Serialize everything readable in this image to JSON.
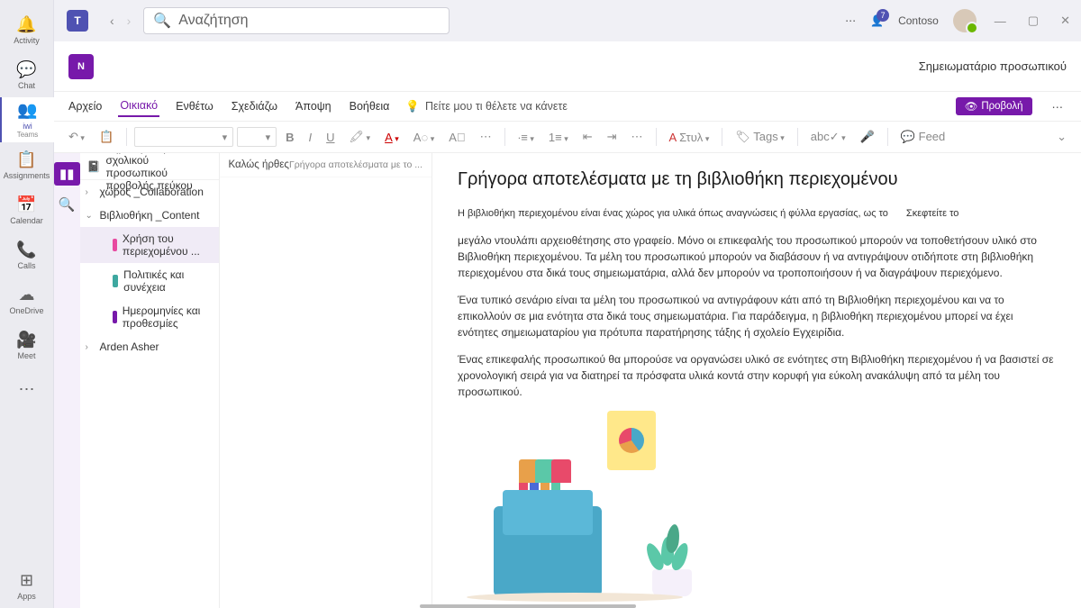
{
  "rail": {
    "items": [
      {
        "label": "Activity",
        "icon": "🔔"
      },
      {
        "label": "Chat",
        "icon": "💬"
      },
      {
        "label": "iwi",
        "sub": "Teams",
        "icon": "👥"
      },
      {
        "label": "Assignments",
        "icon": "📋"
      },
      {
        "label": "Calendar",
        "icon": "📅"
      },
      {
        "label": "Calls",
        "icon": "📞"
      },
      {
        "label": "OneDrive",
        "icon": "☁"
      },
      {
        "label": "Meet",
        "icon": "🎥"
      }
    ],
    "more": "⋯",
    "apps": {
      "label": "Apps",
      "icon": "⊞"
    }
  },
  "titlebar": {
    "search_placeholder": "Αναζήτηση",
    "org": "Contoso",
    "notif_count": "7"
  },
  "app_header": {
    "logo": "N",
    "title": "Σημειωματάριο προσωπικού"
  },
  "menu": {
    "items": [
      "Αρχείο",
      "Οικιακό",
      "Ενθέτω",
      "Σχεδιάζω",
      "Άποψη",
      "Βοήθεια"
    ],
    "tell": "Πείτε μου τι θέλετε να κάνετε",
    "preview": "Προβολή"
  },
  "toolbar": {
    "styles": "Στυλ",
    "tags": "Tags",
    "feed": "Feed"
  },
  "notebook": {
    "title": "Σημειωματάριο σχολικού προσωπικού προβολής πεύκου",
    "sections": [
      {
        "label": "χώρος _Collaboration",
        "chev": "›"
      },
      {
        "label": "Βιβλιοθήκη _Content",
        "chev": "⌄"
      },
      {
        "label": "Χρήση του περιεχομένου ...",
        "indent": true,
        "color": "t-pink",
        "sel": true
      },
      {
        "label": "Πολιτικές και συνέχεια",
        "indent": true,
        "color": "t-teal"
      },
      {
        "label": "Ημερομηνίες και προθεσμίες",
        "indent": true,
        "color": "t-purple"
      },
      {
        "label": "Arden Asher",
        "chev": "›"
      }
    ],
    "pages": [
      {
        "title": "Καλώς ήρθες",
        "snip": "Γρήγορα αποτελέσματα με το ..."
      }
    ]
  },
  "content": {
    "title": "Γρήγορα αποτελέσματα με τη βιβλιοθήκη περιεχομένου",
    "p1a": "Η βιβλιοθήκη περιεχομένου είναι ένας χώρος για υλικά όπως αναγνώσεις ή φύλλα εργασίας, ως το",
    "think": "Σκεφτείτε το",
    "p1b": "μεγάλο ντουλάπι αρχειοθέτησης στο γραφείο. Μόνο οι επικεφαλής του προσωπικού μπορούν να τοποθετήσουν υλικό στο Βιβλιοθήκη περιεχομένου. Τα μέλη του προσωπικού μπορούν να διαβάσουν ή να αντιγράψουν οτιδήποτε στη βιβλιοθήκη περιεχομένου στα δικά τους σημειωματάρια, αλλά δεν μπορούν να τροποποιήσουν ή να διαγράψουν περιεχόμενο.",
    "p2": "Ένα τυπικό σενάριο είναι τα μέλη του προσωπικού να αντιγράφουν κάτι από τη Βιβλιοθήκη περιεχομένου και να το επικολλούν σε μια ενότητα στα δικά τους σημειωματάρια. Για παράδειγμα, η βιβλιοθήκη περιεχομένου μπορεί να έχει ενότητες σημειωματαρίου για πρότυπα παρατήρησης τάξης ή σχολείο Εγχειρίδια.",
    "p3": "Ένας επικεφαλής προσωπικού θα μπορούσε να οργανώσει υλικό σε ενότητες στη Βιβλιοθήκη περιεχομένου ή να βασιστεί σε χρονολογική σειρά για να διατηρεί τα πρόσφατα υλικά κοντά στην κορυφή για εύκολη ανακάλυψη από τα μέλη του προσωπικού."
  }
}
